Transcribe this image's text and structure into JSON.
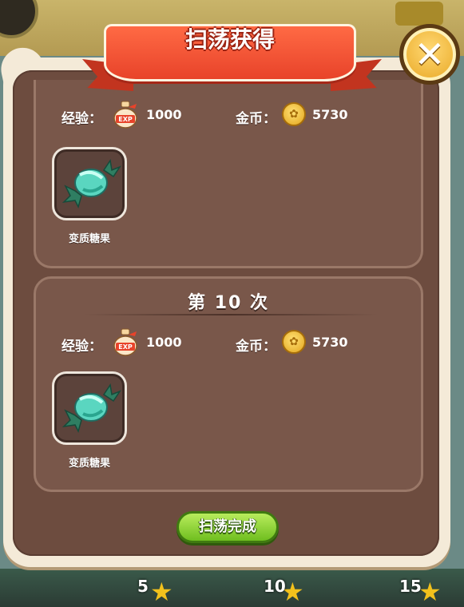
{
  "window": {
    "title": "扫荡获得"
  },
  "close_button": {
    "icon": "close-x-icon"
  },
  "results": [
    {
      "round_label": "",
      "exp_label": "经验：",
      "exp_value": "1000",
      "gold_label": "金币：",
      "gold_value": "5730",
      "items": [
        {
          "name": "变质糖果",
          "icon": "candy-icon"
        }
      ]
    },
    {
      "round_label": "第 10 次",
      "exp_label": "经验：",
      "exp_value": "1000",
      "gold_label": "金币：",
      "gold_value": "5730",
      "items": [
        {
          "name": "变质糖果",
          "icon": "candy-icon"
        }
      ]
    }
  ],
  "footer": {
    "done_label": "扫荡完成"
  },
  "background": {
    "star_marks": [
      "5",
      "10",
      "15"
    ]
  },
  "colors": {
    "banner": "#e8432a",
    "panel_inner": "#6d4c3f",
    "done_button": "#7ccb25",
    "coin": "#f2b62c"
  }
}
